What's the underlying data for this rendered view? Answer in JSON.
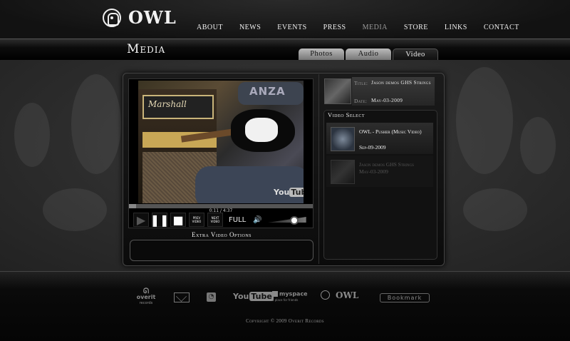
{
  "brand": {
    "name": "OWL",
    "logo_icon": "owl-face-icon"
  },
  "nav": [
    {
      "label": "ABOUT",
      "active": false
    },
    {
      "label": "NEWS",
      "active": false
    },
    {
      "label": "EVENTS",
      "active": false
    },
    {
      "label": "PRESS",
      "active": false
    },
    {
      "label": "MEDIA",
      "active": true
    },
    {
      "label": "STORE",
      "active": false
    },
    {
      "label": "LINKS",
      "active": false
    },
    {
      "label": "CONTACT",
      "active": false
    }
  ],
  "page_title": "Media",
  "tabs": [
    {
      "label": "Photos",
      "active": false
    },
    {
      "label": "Audio",
      "active": false
    },
    {
      "label": "Video",
      "active": true
    }
  ],
  "player": {
    "video_watermark": "You",
    "video_watermark_tube": "Tube",
    "amp_brand": "Marshall",
    "hat_text": "ANZA",
    "time": "0:11 / 4:37",
    "progress_fraction": 0.04,
    "prev_label": "PREV\nVIDEO",
    "next_label": "NEXT\nVIDEO",
    "full_label": "FULL",
    "volume_fraction": 0.5
  },
  "extra_options_title": "Extra Video Options",
  "now_playing": {
    "title_label": "Title:",
    "title_value": "Jason demos GHS Strings",
    "date_label": "Date:",
    "date_value": "May-03-2009"
  },
  "video_select": {
    "heading": "Video Select",
    "items": [
      {
        "name": "OWL - Pusher (Music Video)",
        "date": "Sep-09-2009",
        "active": true
      },
      {
        "name": "Jason demos GHS Strings",
        "date": "May-03-2009",
        "active": false
      }
    ]
  },
  "footer": {
    "overit_name": "overit",
    "overit_sub": "records",
    "youtube_you": "You",
    "youtube_tube": "Tube",
    "myspace": "myspace",
    "myspace_sub": "a place for friends",
    "owl": "OWL",
    "bookmark": "Bookmark",
    "copyright": "Copyright © 2009 Overit Records"
  }
}
